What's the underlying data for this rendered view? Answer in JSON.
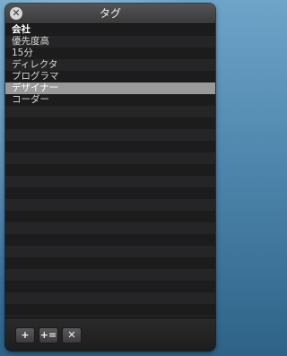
{
  "window": {
    "title": "タグ",
    "close_glyph": "✕"
  },
  "tags": [
    {
      "label": "会社",
      "bold": true,
      "selected": false
    },
    {
      "label": "優先度高",
      "bold": false,
      "selected": false
    },
    {
      "label": "15分",
      "bold": false,
      "selected": false
    },
    {
      "label": "ディレクタ",
      "bold": false,
      "selected": false
    },
    {
      "label": "プログラマ",
      "bold": false,
      "selected": false
    },
    {
      "label": "デザイナー",
      "bold": false,
      "selected": true
    },
    {
      "label": "コーダー",
      "bold": false,
      "selected": false
    }
  ],
  "toolbar": {
    "add_label": "+",
    "add_child_label": "+=",
    "delete_label": "✕"
  }
}
